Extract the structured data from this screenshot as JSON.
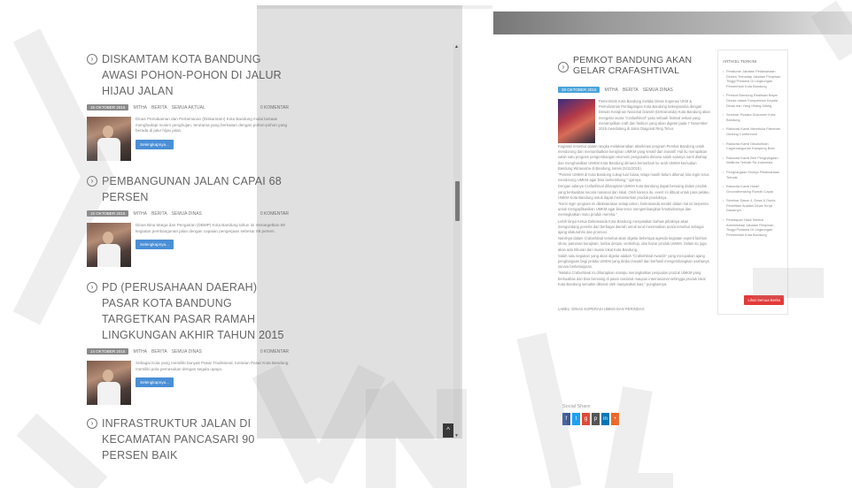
{
  "left_posts": [
    {
      "title": "DISKAMTAM KOTA BANDUNG AWASI POHON-POHON DI JALUR HIJAU JALAN",
      "date": "15 OKTOBER 2015",
      "author": "MITHA",
      "category": "BERITA",
      "sub": "SEMUA AKTUAL",
      "comments": "0 KOMENTAR",
      "excerpt": "Dinas Pemakaman dan Pertamanan (Diskamtam) Kota Bandung mulai lantaas menghadapi musim penghujan, terutama yang berkaitan dengan pohon-pohon yang berada di jalur hijau jalan.",
      "button": "Selengkapnya..."
    },
    {
      "title": "PEMBANGUNAN JALAN CAPAI 68 PERSEN",
      "date": "15 OKTOBER 2015",
      "author": "MITHA",
      "category": "BERITA",
      "sub": "SEMUA DINAS",
      "comments": "0 KOMENTAR",
      "excerpt": "Dinas Bina Marga dan Pengairan (DBMP) Kota Bandung tahun ini menargetkan 68 kegiatan pembangunan jalan dengan capaian pengerjaan sebesar 68 persen.",
      "button": "Selengkapnya..."
    },
    {
      "title": "PD (PERUSAHAAN DAERAH) PASAR KOTA BANDUNG TARGETKAN PASAR RAMAH LINGKUNGAN AKHIR TAHUN 2015",
      "date": "14 OKTOBER 2015",
      "author": "MITHA",
      "category": "BERITA",
      "sub": "SEMUA DINAS",
      "comments": "0 KOMENTAR",
      "excerpt": "Sebagai Kota yang memiliki banyak Pasar Tradisional, tuntutan Pasar Kota Bandung memiliki pola pemasukan dengan segala upaya.",
      "button": "Selengkapnya..."
    },
    {
      "title": "INFRASTRUKTUR JALAN DI KECAMATAN PANCASARI 90 PERSEN BAIK"
    }
  ],
  "viewer": {
    "up_arrow": "▲",
    "down_arrow": "▼",
    "back_to_top": "^"
  },
  "article": {
    "title": "PEMKOT BANDUNG AKAN GELAR CRAFASHTIVAL",
    "date": "28 OKTOBER 2015",
    "author": "MITHA",
    "category": "BERITA",
    "sub": "SEMUA DINAS",
    "intro": "Pemerintah Kota Bandung melalui Dinas Koperasi UKM & Perindustrian Perdagangan Kota Bandung bekerjasama dengan Dewan Kerajinan Nasional Daerah (Dekranasda) Kota Bandung akan mengelar acara \"Crafashtival\" yaitu sebuah festival terkait yang menampilkan craft dan fashion yang akan digelar pada 7 November 2015 mendatang di Jalan Diagonal Ring Timur.",
    "paragraphs": [
      "Kegiatan tersebut dalam rangka melaksanakan akselerasi program Pemkot Bandung untuk mendorong dan memanfaatkan kerajinan UMKM yang kreatif dan inovatif. Hal itu merupakan salah satu program pengembangan ekonomi pengusaha dimana salah satunya nanti ditahap dan menghasilkan UMKM Kota Bandung dimana bertumbuh ke arah UMKM kemudian Bandung Wirausaha di Bandung, kamis (5/11/2015).",
      "\"Potensi UMKM di Kota Bandung cukup luar biasa, tetapi masih belum dikenal, kita ingin terus mendorong UMKM agar bisa berkembang,\" ujarnya.",
      "Dengan adanya Crafashtival diharapkan UMKM Kota Bandung dapat bersaing dalam produk yang berkualitas secara nasional dan lokal. Oleh karena itu, event ini dibuat untuk para pelaku UMKM Kota Bandung untuk dapat memamerkan produk-produknya.",
      "\"Kami ingin program ini dilaksanakan setiap tahun, Dekranasda sendiri dalam hal ini berperan untuk mengaplikasikan UMKM agar bisa terus mengembangkan kreativitasnya dan meningkatkan mutu produk mereka.\"",
      "Lebih lanjut Ketua Dekranasda Kota Bandung menyatakan bahwa pihaknya akan mengundang peserta dari berbagai daerah untuk turut meramaikan acara tersebut sebagai ajang silaturahmi dan promosi.",
      "Nantinya dalam Crafashtival tersebut akan digelar beberapa agenda kegiatan seperti fashion show, pameran kerajinan, lomba desain, workshop, dan bazar produk UMKM. Selain itu juga akan ada hiburan dari musisi lokal Kota Bandung.",
      "Salah satu kegiatan yang akan digelar adalah \"Crafashtival Awards\" yang merupakan ajang penghargaan bagi pelaku UMKM yang dinilai inovatif dan berhasil mengembangkan usahanya secara berkelanjutan.",
      "\"Melalui Crafashtival ini diharapkan mampu meningkatkan penjualan produk UMKM yang berkualitas dan bisa bersaing di pasar nasional maupun internasional sehingga produk lokal Kota Bandung semakin dikenal oleh masyarakat luas,\" pungkasnya."
    ],
    "tags": "LABEL: DINAS KOPERASI UMKM DAN PERINDAG"
  },
  "share": {
    "label": "Social Share:",
    "icons": [
      {
        "name": "facebook-icon",
        "glyph": "f",
        "color": "#3b5998"
      },
      {
        "name": "twitter-icon",
        "glyph": "t",
        "color": "#1da1f2"
      },
      {
        "name": "google-plus-icon",
        "glyph": "g",
        "color": "#dd4b39"
      },
      {
        "name": "pinterest-icon",
        "glyph": "p",
        "color": "#555555"
      },
      {
        "name": "linkedin-icon",
        "glyph": "in",
        "color": "#0077b5"
      },
      {
        "name": "more-share-icon",
        "glyph": "+",
        "color": "#f26522"
      }
    ]
  },
  "sidebar": {
    "title": "ARTIKEL TERKINI",
    "items": [
      "Peraturan Jabatan Pelaksanaan Dinkes Terhadap Jabatan Pimpinan Tinggi Pratama Di Lingkungan Pemerintah Kota Bandung",
      "Pemkot Bandung Realisasi Bayar Denda dalam Kompetensi Kepala Dinas dan Yang Hilang-hilang",
      "Seminar Pusaka Dokumen Kota Bandung",
      "Rakorasi Kamil Membuka Pameran Gedung Conference",
      "Rakorasi Kamil Dikukuhkan Cagarbangunan Kampung Bobi",
      "Rakorasi Kamil Beri Penghargaan Walikota Terbaik Se-Indonesia",
      "Penghargaan Kinerja Pelaksanaan Terbaik",
      "Rakorasi Kamil Hadiri Groundbreaking Rumah Capai",
      "Seminar Dasar 4, Dosa & Dunia Penelitian Analisa Dinas Kerja Dasarnya",
      "Penetapan Hasil Seleksi Administrasi Jabatan Pimpinan Tinggi Pratama Di Lingkungan Pemerintah Kota Bandung"
    ],
    "more_button": "Lihat Semua Berita"
  }
}
